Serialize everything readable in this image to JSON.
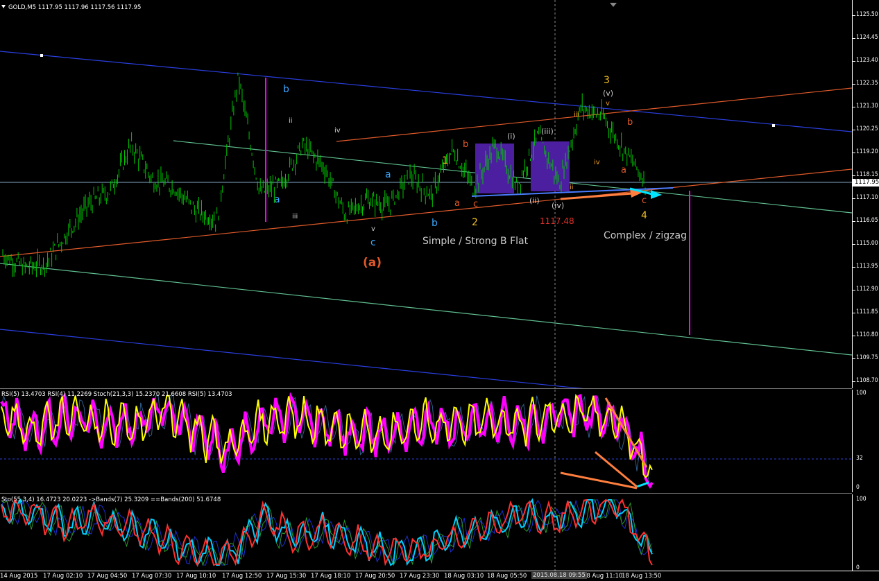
{
  "header": {
    "main": "GOLD,M5  1117.95 1117.96 1117.56 1117.95",
    "rsi_pane": "RSI(5) 13.4703  RSI(4) 11.2269  Stoch(21,3,3) 15.2370 21.6608  RSI(5) 13.4703",
    "sto_pane": "Sto(55,3,4) 16.4723 20.0223  ->Bands(7) 25.3209  ==Bands(200) 51.6748"
  },
  "colors": {
    "background": "#000000",
    "candles": "#00c800",
    "channel_blue": "#2a3fe0",
    "channel_green": "#60c090",
    "channel_red": "#e05a2a",
    "box_purple": "#4b1fa0",
    "magenta": "#ff00ff",
    "yellow": "#ffff00",
    "orange_arrow": "#ff7f3f",
    "cyan_arrow": "#00e5ff"
  },
  "price_axis": {
    "ticks": [
      "1125.50",
      "1124.45",
      "1123.40",
      "1122.35",
      "1121.30",
      "1120.25",
      "1119.20",
      "1118.15",
      "1117.10",
      "1116.05",
      "1115.00",
      "1113.95",
      "1112.90",
      "1111.85",
      "1110.80",
      "1109.75",
      "1108.70"
    ],
    "current": "1117.95"
  },
  "rsi_axis": {
    "ticks": [
      "100",
      "32",
      "0"
    ]
  },
  "sto_axis": {
    "ticks": [
      "100",
      "0"
    ]
  },
  "time_axis": {
    "ticks": [
      "14 Aug 2015",
      "17 Aug 02:10",
      "17 Aug 04:50",
      "17 Aug 07:30",
      "17 Aug 10:10",
      "17 Aug 12:50",
      "17 Aug 15:30",
      "17 Aug 18:10",
      "17 Aug 20:50",
      "17 Aug 23:30",
      "18 Aug 03:10",
      "18 Aug 05:50",
      "18 Aug 11:10",
      "18 Aug 13:50"
    ],
    "crosshair": "2015.08.18 09:55"
  },
  "annotations": {
    "wave_a": "(a)",
    "simple_flat": "Simple / Strong B Flat",
    "complex_zigzag": "Complex / zigzag",
    "price_mark": "1117.48",
    "w1": "1",
    "w2": "2",
    "w3": "3",
    "w4": "4",
    "w3_v_paren": "(v)",
    "w3_v": "v",
    "b1": "b",
    "a1": "a",
    "ii1": "ii",
    "iii1": "iii",
    "iv1": "iv",
    "v1": "v",
    "c1": "c",
    "a2": "a",
    "b2": "b",
    "b3": "b",
    "a3": "a",
    "c3": "c",
    "i_paren": "(i)",
    "ii_paren": "(ii)",
    "iii_paren": "(iii)",
    "iv_paren": "(iv)",
    "iii2": "iii",
    "ii2": "ii",
    "iv2": "iv",
    "b4": "b",
    "a4": "a",
    "c4": "c"
  },
  "chart_data": [
    {
      "type": "line",
      "title": "GOLD,M5",
      "series": [
        {
          "name": "GOLD",
          "values": [
            1114.6,
            1114.0,
            1114.2,
            1115.6,
            1116.9,
            1117.5,
            1119.6,
            1118.0,
            1117.7,
            1116.6,
            1116.2,
            1122.7,
            1117.4,
            1117.8,
            1119.6,
            1118.6,
            1116.4,
            1117.1,
            1116.8,
            1118.2,
            1117.3,
            1119.4,
            1117.6,
            1119.6,
            1117.7,
            1120.0,
            1117.8,
            1121.3,
            1120.9,
            1119.4,
            1117.95
          ]
        }
      ],
      "ylim": [
        1108.7,
        1125.5
      ],
      "annotations": [
        "(a)",
        "Simple / Strong B Flat",
        "Complex / zigzag",
        "1117.48"
      ]
    },
    {
      "type": "line",
      "title": "RSI(5) 13.4703 RSI(4) 11.2269 Stoch(21,3,3) 15.2370 21.6608",
      "series": [
        {
          "name": "RSI(5)",
          "values": [
            80,
            60,
            75,
            70,
            65,
            85,
            60,
            40,
            70,
            75,
            65,
            55,
            60,
            70,
            65,
            72,
            68,
            75,
            80,
            70,
            13.47
          ]
        }
      ],
      "ylim": [
        0,
        100
      ],
      "levels": [
        32
      ]
    },
    {
      "type": "line",
      "title": "Sto(55,3,4) 16.4723 20.0223",
      "series": [
        {
          "name": "Sto(55,3,4)",
          "values": [
            85,
            80,
            60,
            70,
            55,
            40,
            20,
            15,
            70,
            40,
            55,
            35,
            20,
            25,
            45,
            60,
            75,
            70,
            80,
            90,
            16.47
          ]
        }
      ],
      "ylim": [
        0,
        100
      ]
    }
  ]
}
